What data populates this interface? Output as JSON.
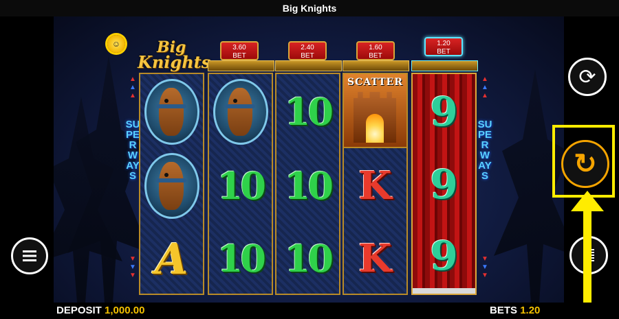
{
  "window": {
    "title": "Big Knights"
  },
  "logo": {
    "line1": "Big",
    "line2": "Knights",
    "brand_icon": "sun-mascot-icon"
  },
  "bets": [
    {
      "value": "3.60",
      "label": "BET",
      "active": false
    },
    {
      "value": "2.40",
      "label": "BET",
      "active": false
    },
    {
      "value": "1.60",
      "label": "BET",
      "active": false
    },
    {
      "value": "1.20",
      "label": "BET",
      "active": true
    }
  ],
  "superways": {
    "text": "SUPERWAYS"
  },
  "reels": [
    [
      "horse",
      "horse",
      "A"
    ],
    [
      "horse",
      "10",
      "10"
    ],
    [
      "10",
      "10",
      "10"
    ],
    [
      "scatter",
      "K",
      "K"
    ],
    [
      "9",
      "9",
      "9"
    ]
  ],
  "scatter_label": "SCATTER",
  "symbols": {
    "ten": "10",
    "nine": "9",
    "k": "K",
    "a": "A"
  },
  "controls": {
    "autoplay_icon": "refresh-icon",
    "spin_icon": "spin-arrow-icon",
    "spin_glyph": "↻",
    "autoplay_glyph": "⟳",
    "bet_icon": "coin-stack-icon",
    "menu_icon": "hamburger-menu-icon"
  },
  "footer": {
    "deposit_label": "DEPOSIT",
    "deposit_value": "1,000.00",
    "bets_label": "BETS",
    "bets_value": "1.20"
  },
  "colors": {
    "highlight": "#ffec00",
    "spin": "#f5a400",
    "bet_tag": "#c81a1a",
    "reel_frame": "#b98b27"
  }
}
